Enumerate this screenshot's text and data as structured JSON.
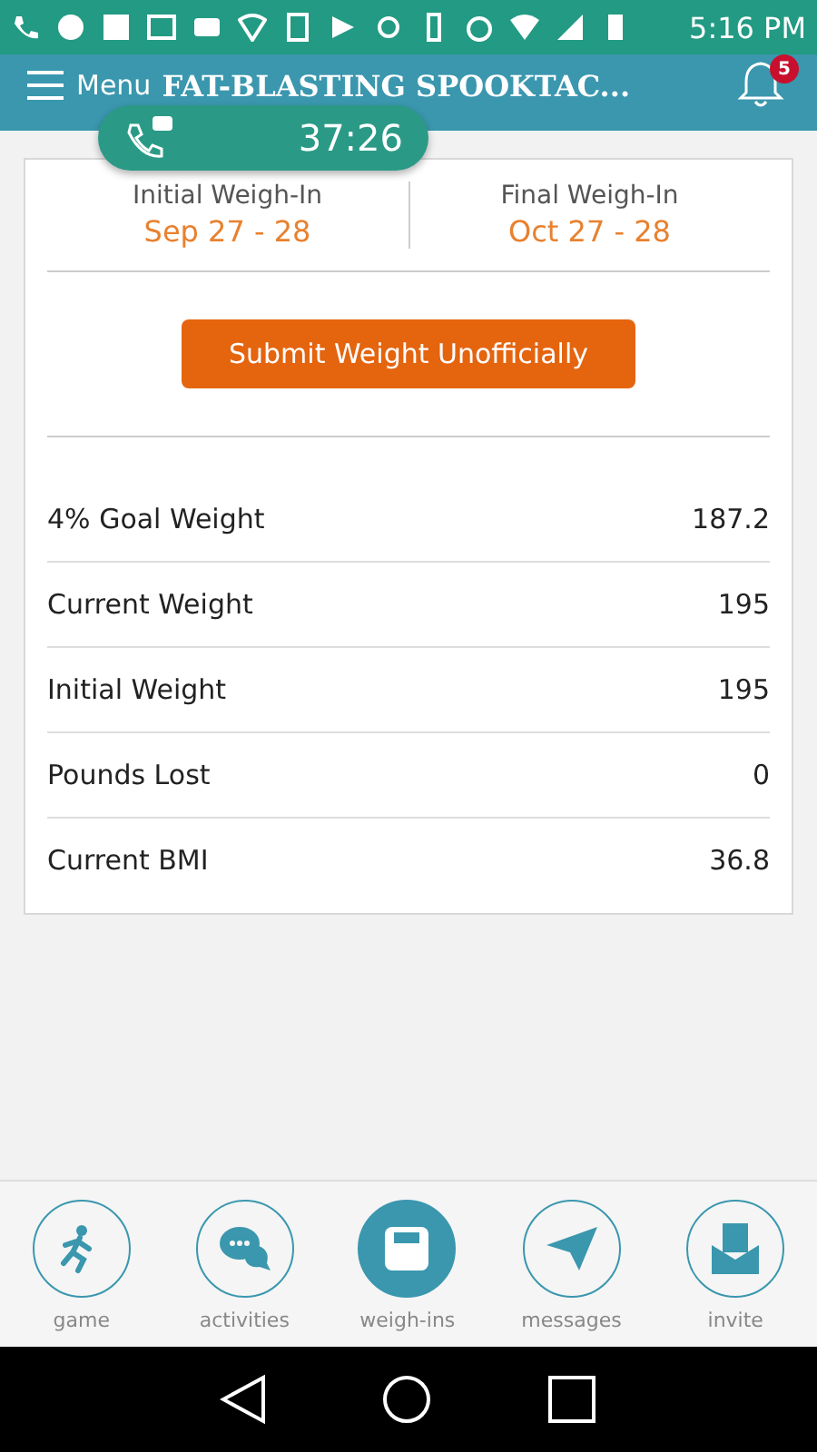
{
  "status_bar": {
    "time": "5:16 PM"
  },
  "header": {
    "menu_label": "Menu",
    "title": "FAT-BLASTING SPOOKTAC...",
    "notification_count": "5"
  },
  "call_overlay": {
    "timer": "37:26"
  },
  "weigh_in_dates": [
    {
      "label": "Initial Weigh-In",
      "dates": "Sep 27 - 28"
    },
    {
      "label": "Final Weigh-In",
      "dates": "Oct 27 - 28"
    }
  ],
  "submit_button": "Submit Weight Unofficially",
  "stats": [
    {
      "label": "4% Goal Weight",
      "value": "187.2"
    },
    {
      "label": "Current Weight",
      "value": "195"
    },
    {
      "label": "Initial Weight",
      "value": "195"
    },
    {
      "label": "Pounds Lost",
      "value": "0"
    },
    {
      "label": "Current BMI",
      "value": "36.8"
    }
  ],
  "bottom_nav": [
    {
      "kind": "game",
      "label": "game",
      "selected": false
    },
    {
      "kind": "activities",
      "label": "activities",
      "selected": false
    },
    {
      "kind": "weigh-ins",
      "label": "weigh-ins",
      "selected": true
    },
    {
      "kind": "messages",
      "label": "messages",
      "selected": false
    },
    {
      "kind": "invite",
      "label": "invite",
      "selected": false
    }
  ]
}
